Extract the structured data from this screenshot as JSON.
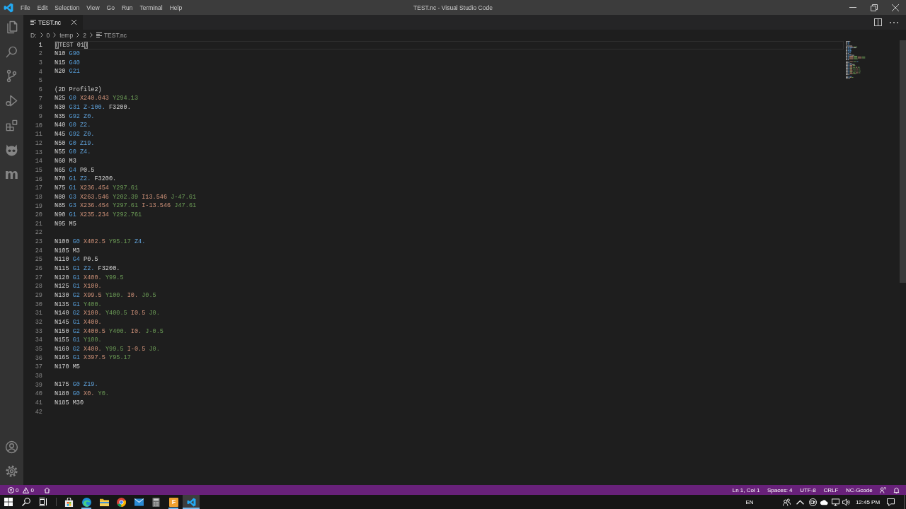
{
  "window": {
    "title": "TEST.nc - Visual Studio Code",
    "menu": [
      "File",
      "Edit",
      "Selection",
      "View",
      "Go",
      "Run",
      "Terminal",
      "Help"
    ]
  },
  "activity_bar": {
    "glyph_icon": "m"
  },
  "tabs": [
    {
      "label": "TEST.nc",
      "selected": true
    }
  ],
  "breadcrumbs": [
    {
      "label": "D:",
      "kind": "folder"
    },
    {
      "label": "0",
      "kind": "folder"
    },
    {
      "label": "temp",
      "kind": "folder"
    },
    {
      "label": "2",
      "kind": "folder"
    },
    {
      "label": "TEST.nc",
      "kind": "file"
    }
  ],
  "editor": {
    "lines": [
      {
        "number": "1",
        "current": true,
        "tokens": [
          {
            "text": "(",
            "kind": "bracket"
          },
          {
            "text": "TEST 01",
            "kind": "plain"
          },
          {
            "text": ")",
            "kind": "bracket"
          }
        ]
      },
      {
        "number": "2",
        "current": false,
        "tokens": [
          {
            "text": "N10",
            "kind": "plain"
          },
          {
            "text": "G90",
            "kind": "gcode"
          }
        ]
      },
      {
        "number": "3",
        "current": false,
        "tokens": [
          {
            "text": "N15",
            "kind": "plain"
          },
          {
            "text": "G40",
            "kind": "gcode"
          }
        ]
      },
      {
        "number": "4",
        "current": false,
        "tokens": [
          {
            "text": "N20",
            "kind": "plain"
          },
          {
            "text": "G21",
            "kind": "gcode"
          }
        ]
      },
      {
        "number": "5",
        "current": false
      },
      {
        "number": "6",
        "current": false,
        "tokens": [
          {
            "text": "(2D Profile2)",
            "kind": "plain"
          }
        ]
      },
      {
        "number": "7",
        "current": false,
        "tokens": [
          {
            "text": "N25",
            "kind": "plain"
          },
          {
            "text": "G0",
            "kind": "gcode"
          },
          {
            "text": "X240.043",
            "kind": "x"
          },
          {
            "text": "Y294.13",
            "kind": "y"
          }
        ]
      },
      {
        "number": "8",
        "current": false,
        "tokens": [
          {
            "text": "N30",
            "kind": "plain"
          },
          {
            "text": "G31",
            "kind": "gcode"
          },
          {
            "text": "Z-100.",
            "kind": "z"
          },
          {
            "text": "F3200.",
            "kind": "plain"
          }
        ]
      },
      {
        "number": "9",
        "current": false,
        "tokens": [
          {
            "text": "N35",
            "kind": "plain"
          },
          {
            "text": "G92",
            "kind": "gcode"
          },
          {
            "text": "Z0.",
            "kind": "z"
          }
        ]
      },
      {
        "number": "10",
        "current": false,
        "tokens": [
          {
            "text": "N40",
            "kind": "plain"
          },
          {
            "text": "G0",
            "kind": "gcode"
          },
          {
            "text": "Z2.",
            "kind": "z"
          }
        ]
      },
      {
        "number": "11",
        "current": false,
        "tokens": [
          {
            "text": "N45",
            "kind": "plain"
          },
          {
            "text": "G92",
            "kind": "gcode"
          },
          {
            "text": "Z0.",
            "kind": "z"
          }
        ]
      },
      {
        "number": "12",
        "current": false,
        "tokens": [
          {
            "text": "N50",
            "kind": "plain"
          },
          {
            "text": "G0",
            "kind": "gcode"
          },
          {
            "text": "Z19.",
            "kind": "z"
          }
        ]
      },
      {
        "number": "13",
        "current": false,
        "tokens": [
          {
            "text": "N55",
            "kind": "plain"
          },
          {
            "text": "G0",
            "kind": "gcode"
          },
          {
            "text": "Z4.",
            "kind": "z"
          }
        ]
      },
      {
        "number": "14",
        "current": false,
        "tokens": [
          {
            "text": "N60",
            "kind": "plain"
          },
          {
            "text": "M3",
            "kind": "plain"
          }
        ]
      },
      {
        "number": "15",
        "current": false,
        "tokens": [
          {
            "text": "N65",
            "kind": "plain"
          },
          {
            "text": "G4",
            "kind": "gcode"
          },
          {
            "text": "P0.5",
            "kind": "plain"
          }
        ]
      },
      {
        "number": "16",
        "current": false,
        "tokens": [
          {
            "text": "N70",
            "kind": "plain"
          },
          {
            "text": "G1",
            "kind": "gcode"
          },
          {
            "text": "Z2.",
            "kind": "z"
          },
          {
            "text": "F3200.",
            "kind": "plain"
          }
        ]
      },
      {
        "number": "17",
        "current": false,
        "tokens": [
          {
            "text": "N75",
            "kind": "plain"
          },
          {
            "text": "G1",
            "kind": "gcode"
          },
          {
            "text": "X236.454",
            "kind": "x"
          },
          {
            "text": "Y297.61",
            "kind": "y"
          }
        ]
      },
      {
        "number": "18",
        "current": false,
        "tokens": [
          {
            "text": "N80",
            "kind": "plain"
          },
          {
            "text": "G3",
            "kind": "gcode"
          },
          {
            "text": "X263.546",
            "kind": "x"
          },
          {
            "text": "Y202.39",
            "kind": "y"
          },
          {
            "text": "I13.546",
            "kind": "i"
          },
          {
            "text": "J-47.61",
            "kind": "j"
          }
        ]
      },
      {
        "number": "19",
        "current": false,
        "tokens": [
          {
            "text": "N85",
            "kind": "plain"
          },
          {
            "text": "G3",
            "kind": "gcode"
          },
          {
            "text": "X236.454",
            "kind": "x"
          },
          {
            "text": "Y297.61",
            "kind": "y"
          },
          {
            "text": "I-13.546",
            "kind": "i"
          },
          {
            "text": "J47.61",
            "kind": "j"
          }
        ]
      },
      {
        "number": "20",
        "current": false,
        "tokens": [
          {
            "text": "N90",
            "kind": "plain"
          },
          {
            "text": "G1",
            "kind": "gcode"
          },
          {
            "text": "X235.234",
            "kind": "x"
          },
          {
            "text": "Y292.761",
            "kind": "y"
          }
        ]
      },
      {
        "number": "21",
        "current": false,
        "tokens": [
          {
            "text": "N95",
            "kind": "plain"
          },
          {
            "text": "M5",
            "kind": "plain"
          }
        ]
      },
      {
        "number": "22",
        "current": false
      },
      {
        "number": "23",
        "current": false,
        "tokens": [
          {
            "text": "N100",
            "kind": "plain"
          },
          {
            "text": "G0",
            "kind": "gcode"
          },
          {
            "text": "X402.5",
            "kind": "x"
          },
          {
            "text": "Y95.17",
            "kind": "y"
          },
          {
            "text": "Z4.",
            "kind": "z"
          }
        ]
      },
      {
        "number": "24",
        "current": false,
        "tokens": [
          {
            "text": "N105",
            "kind": "plain"
          },
          {
            "text": "M3",
            "kind": "plain"
          }
        ]
      },
      {
        "number": "25",
        "current": false,
        "tokens": [
          {
            "text": "N110",
            "kind": "plain"
          },
          {
            "text": "G4",
            "kind": "gcode"
          },
          {
            "text": "P0.5",
            "kind": "plain"
          }
        ]
      },
      {
        "number": "26",
        "current": false,
        "tokens": [
          {
            "text": "N115",
            "kind": "plain"
          },
          {
            "text": "G1",
            "kind": "gcode"
          },
          {
            "text": "Z2.",
            "kind": "z"
          },
          {
            "text": "F3200.",
            "kind": "plain"
          }
        ]
      },
      {
        "number": "27",
        "current": false,
        "tokens": [
          {
            "text": "N120",
            "kind": "plain"
          },
          {
            "text": "G1",
            "kind": "gcode"
          },
          {
            "text": "X400.",
            "kind": "x"
          },
          {
            "text": "Y99.5",
            "kind": "y"
          }
        ]
      },
      {
        "number": "28",
        "current": false,
        "tokens": [
          {
            "text": "N125",
            "kind": "plain"
          },
          {
            "text": "G1",
            "kind": "gcode"
          },
          {
            "text": "X100.",
            "kind": "x"
          }
        ]
      },
      {
        "number": "29",
        "current": false,
        "tokens": [
          {
            "text": "N130",
            "kind": "plain"
          },
          {
            "text": "G2",
            "kind": "gcode"
          },
          {
            "text": "X99.5",
            "kind": "x"
          },
          {
            "text": "Y100.",
            "kind": "y"
          },
          {
            "text": "I0.",
            "kind": "i"
          },
          {
            "text": "J0.5",
            "kind": "j"
          }
        ]
      },
      {
        "number": "30",
        "current": false,
        "tokens": [
          {
            "text": "N135",
            "kind": "plain"
          },
          {
            "text": "G1",
            "kind": "gcode"
          },
          {
            "text": "Y400.",
            "kind": "y"
          }
        ]
      },
      {
        "number": "31",
        "current": false,
        "tokens": [
          {
            "text": "N140",
            "kind": "plain"
          },
          {
            "text": "G2",
            "kind": "gcode"
          },
          {
            "text": "X100.",
            "kind": "x"
          },
          {
            "text": "Y400.5",
            "kind": "y"
          },
          {
            "text": "I0.5",
            "kind": "i"
          },
          {
            "text": "J0.",
            "kind": "j"
          }
        ]
      },
      {
        "number": "32",
        "current": false,
        "tokens": [
          {
            "text": "N145",
            "kind": "plain"
          },
          {
            "text": "G1",
            "kind": "gcode"
          },
          {
            "text": "X400.",
            "kind": "x"
          }
        ]
      },
      {
        "number": "33",
        "current": false,
        "tokens": [
          {
            "text": "N150",
            "kind": "plain"
          },
          {
            "text": "G2",
            "kind": "gcode"
          },
          {
            "text": "X400.5",
            "kind": "x"
          },
          {
            "text": "Y400.",
            "kind": "y"
          },
          {
            "text": "I0.",
            "kind": "i"
          },
          {
            "text": "J-0.5",
            "kind": "j"
          }
        ]
      },
      {
        "number": "34",
        "current": false,
        "tokens": [
          {
            "text": "N155",
            "kind": "plain"
          },
          {
            "text": "G1",
            "kind": "gcode"
          },
          {
            "text": "Y100.",
            "kind": "y"
          }
        ]
      },
      {
        "number": "35",
        "current": false,
        "tokens": [
          {
            "text": "N160",
            "kind": "plain"
          },
          {
            "text": "G2",
            "kind": "gcode"
          },
          {
            "text": "X400.",
            "kind": "x"
          },
          {
            "text": "Y99.5",
            "kind": "y"
          },
          {
            "text": "I-0.5",
            "kind": "i"
          },
          {
            "text": "J0.",
            "kind": "j"
          }
        ]
      },
      {
        "number": "36",
        "current": false,
        "tokens": [
          {
            "text": "N165",
            "kind": "plain"
          },
          {
            "text": "G1",
            "kind": "gcode"
          },
          {
            "text": "X397.5",
            "kind": "x"
          },
          {
            "text": "Y95.17",
            "kind": "y"
          }
        ]
      },
      {
        "number": "37",
        "current": false,
        "tokens": [
          {
            "text": "N170",
            "kind": "plain"
          },
          {
            "text": "M5",
            "kind": "plain"
          }
        ]
      },
      {
        "number": "38",
        "current": false
      },
      {
        "number": "39",
        "current": false,
        "tokens": [
          {
            "text": "N175",
            "kind": "plain"
          },
          {
            "text": "G0",
            "kind": "gcode"
          },
          {
            "text": "Z19.",
            "kind": "z"
          }
        ]
      },
      {
        "number": "40",
        "current": false,
        "tokens": [
          {
            "text": "N180",
            "kind": "plain"
          },
          {
            "text": "G0",
            "kind": "gcode"
          },
          {
            "text": "X0.",
            "kind": "x"
          },
          {
            "text": "Y0.",
            "kind": "y"
          }
        ]
      },
      {
        "number": "41",
        "current": false,
        "tokens": [
          {
            "text": "N185",
            "kind": "plain"
          },
          {
            "text": "M30",
            "kind": "plain"
          }
        ]
      },
      {
        "number": "42",
        "current": false
      }
    ]
  },
  "status_bar": {
    "errors": "0",
    "warnings": "0",
    "items": [
      "Ln 1, Col 1",
      "Spaces: 4",
      "UTF-8",
      "CRLF",
      "NC-Gcode"
    ]
  },
  "taskbar": {
    "apps": [
      {
        "kind": "bag",
        "running": false,
        "selected": false
      },
      {
        "kind": "swirl",
        "running": true,
        "selected": false
      },
      {
        "kind": "folder",
        "running": false,
        "selected": false
      },
      {
        "kind": "wheel",
        "running": false,
        "selected": false
      },
      {
        "kind": "mail",
        "running": false,
        "selected": false
      },
      {
        "kind": "calculator",
        "running": false,
        "selected": false
      },
      {
        "kind": "letter",
        "glyph": "F",
        "running": true,
        "selected": false
      },
      {
        "kind": "editor",
        "running": true,
        "selected": true
      }
    ],
    "language": "EN",
    "clock": "12:45 PM"
  }
}
